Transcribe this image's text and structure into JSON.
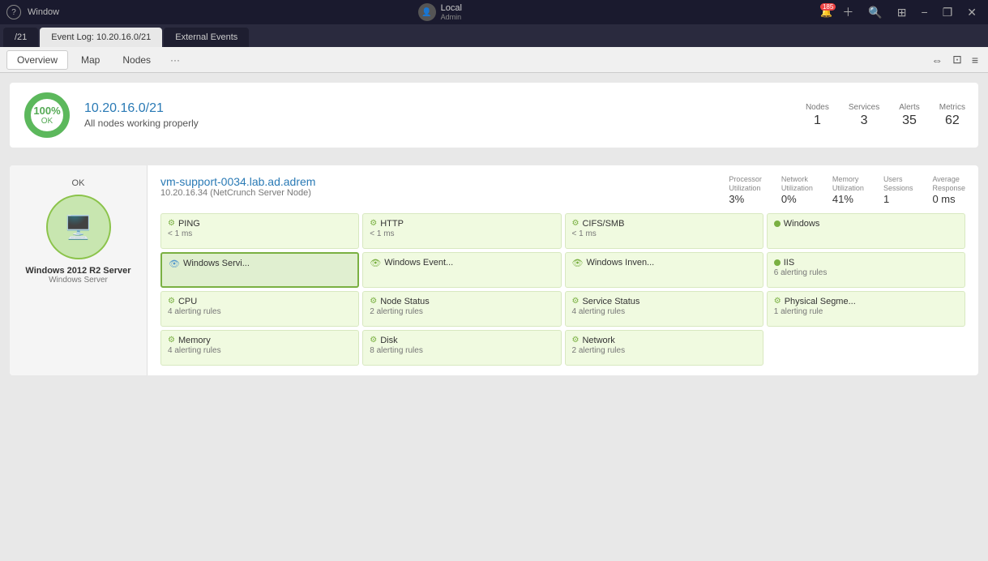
{
  "titleBar": {
    "windowTitle": "Window",
    "helpLabel": "?",
    "user": {
      "name": "Local",
      "role": "Admin"
    },
    "notificationCount": "185",
    "buttons": {
      "minimize": "−",
      "maximize": "❐",
      "close": "✕"
    }
  },
  "tabs": [
    {
      "id": "main",
      "label": "/21"
    },
    {
      "id": "eventlog",
      "label": "Event Log: 10.20.16.0/21",
      "active": true
    },
    {
      "id": "external",
      "label": "External Events"
    }
  ],
  "secondaryNav": {
    "items": [
      {
        "id": "overview",
        "label": "Overview",
        "active": true
      },
      {
        "id": "map",
        "label": "Map"
      },
      {
        "id": "nodes",
        "label": "Nodes"
      },
      {
        "id": "more",
        "label": "···"
      }
    ]
  },
  "statusBar": {
    "donut": {
      "percentage": "100%",
      "status": "OK",
      "color": "#5cb85c"
    },
    "networkTitle": "10.20.16.0/21",
    "networkStatus": "All nodes working properly",
    "metrics": [
      {
        "label": "Nodes",
        "value": "1"
      },
      {
        "label": "Services",
        "value": "3"
      },
      {
        "label": "Alerts",
        "value": "35"
      },
      {
        "label": "Metrics",
        "value": "62"
      }
    ]
  },
  "nodeCard": {
    "status": "OK",
    "nodeName": "Windows 2012 R2 Server",
    "nodeType": "Windows Server",
    "hostname": "vm-support-0034.lab.ad.adrem",
    "ip": "10.20.16.34 (NetCrunch Server Node)",
    "metrics": [
      {
        "label": "Processor\nUtilization",
        "value": "3%"
      },
      {
        "label": "Network\nUtilization",
        "value": "0%"
      },
      {
        "label": "Memory\nUtilization",
        "value": "41%"
      },
      {
        "label": "Users\nSessions",
        "value": "1"
      },
      {
        "label": "Average\nResponse",
        "value": "0 ms"
      }
    ],
    "services": [
      {
        "id": "ping",
        "name": "PING",
        "sub": "< 1 ms",
        "type": "gear"
      },
      {
        "id": "http",
        "name": "HTTP",
        "sub": "< 1 ms",
        "type": "gear"
      },
      {
        "id": "cifs",
        "name": "CIFS/SMB",
        "sub": "< 1 ms",
        "type": "gear"
      },
      {
        "id": "windows",
        "name": "Windows",
        "sub": "",
        "type": "dot"
      },
      {
        "id": "winservi",
        "name": "Windows Servi...",
        "sub": "",
        "type": "eye",
        "highlight": true
      },
      {
        "id": "winevent",
        "name": "Windows Event...",
        "sub": "",
        "type": "eye"
      },
      {
        "id": "wininven",
        "name": "Windows Inven...",
        "sub": "",
        "type": "eye"
      },
      {
        "id": "iis",
        "name": "IIS",
        "sub": "6 alerting rules",
        "type": "dot"
      },
      {
        "id": "cpu",
        "name": "CPU",
        "sub": "4 alerting rules",
        "type": "gear"
      },
      {
        "id": "nodestatus",
        "name": "Node Status",
        "sub": "2 alerting rules",
        "type": "gear"
      },
      {
        "id": "servicestatus",
        "name": "Service Status",
        "sub": "4 alerting rules",
        "type": "gear"
      },
      {
        "id": "physicalse",
        "name": "Physical Segme...",
        "sub": "1 alerting rule",
        "type": "gear"
      },
      {
        "id": "memory",
        "name": "Memory",
        "sub": "4 alerting rules",
        "type": "gear"
      },
      {
        "id": "disk",
        "name": "Disk",
        "sub": "8 alerting rules",
        "type": "gear"
      },
      {
        "id": "network",
        "name": "Network",
        "sub": "2 alerting rules",
        "type": "gear"
      }
    ]
  }
}
